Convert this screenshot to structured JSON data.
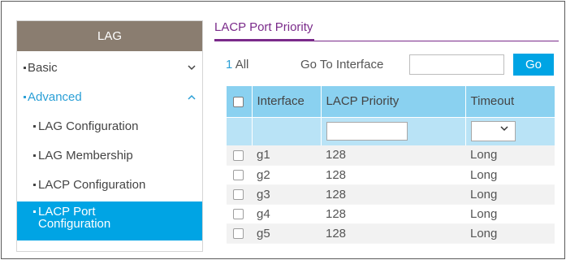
{
  "sidebar": {
    "header": "LAG",
    "basic": {
      "label": "Basic",
      "chevron": "chevron-down-icon"
    },
    "advanced": {
      "label": "Advanced",
      "chevron": "chevron-up-icon"
    },
    "items": [
      {
        "label": "LAG Configuration",
        "active": false
      },
      {
        "label": "LAG Membership",
        "active": false
      },
      {
        "label": "LACP Configuration",
        "active": false
      },
      {
        "label": "LACP Port Configuration",
        "active": true
      }
    ]
  },
  "main": {
    "title": "LACP Port Priority",
    "count_num": "1",
    "count_label": "All",
    "goto_label": "Go To Interface",
    "goto_value": "",
    "go_button": "Go"
  },
  "table": {
    "columns": [
      "",
      "Interface",
      "LACP Priority",
      "Timeout"
    ],
    "rows": [
      {
        "interface": "g1",
        "priority": "128",
        "timeout": "Long"
      },
      {
        "interface": "g2",
        "priority": "128",
        "timeout": "Long"
      },
      {
        "interface": "g3",
        "priority": "128",
        "timeout": "Long"
      },
      {
        "interface": "g4",
        "priority": "128",
        "timeout": "Long"
      },
      {
        "interface": "g5",
        "priority": "128",
        "timeout": "Long"
      }
    ]
  },
  "colors": {
    "accent": "#00a4e4",
    "header_bg": "#8a7d70",
    "tab_purple": "#7a2a8a",
    "table_header": "#8ad1f0"
  }
}
